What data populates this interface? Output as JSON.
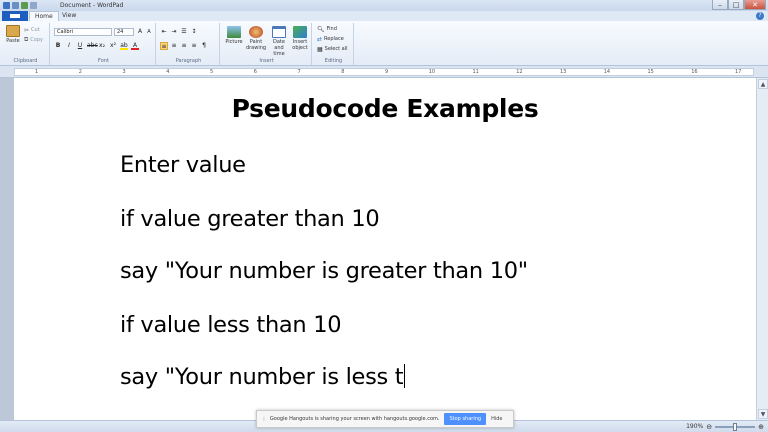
{
  "window": {
    "title": "Document - WordPad",
    "minimize": "–",
    "maximize": "□",
    "close": "✕"
  },
  "tabs": {
    "file": "",
    "home": "Home",
    "view": "View",
    "help": "?"
  },
  "ribbon": {
    "clipboard": {
      "paste": "Paste",
      "cut": "Cut",
      "copy": "Copy",
      "label": "Clipboard"
    },
    "font": {
      "family": "Calibri",
      "size": "24",
      "label": "Font",
      "bold": "B",
      "italic": "I",
      "underline": "U"
    },
    "paragraph": {
      "label": "Paragraph"
    },
    "insert": {
      "picture": "Picture",
      "paint": "Paint drawing",
      "datetime": "Date and time",
      "object": "Insert object",
      "label": "Insert"
    },
    "editing": {
      "find": "Find",
      "replace": "Replace",
      "select_all": "Select all",
      "label": "Editing"
    }
  },
  "ruler": {
    "ticks": [
      "1",
      "2",
      "3",
      "4",
      "5",
      "6",
      "7",
      "8",
      "9",
      "10",
      "11",
      "12",
      "13",
      "14",
      "15",
      "16",
      "17"
    ]
  },
  "document": {
    "title": "Pseudocode Examples",
    "lines": [
      "Enter value",
      "if value greater than 10",
      "say \"Your number is greater than 10\"",
      "if value less than 10",
      "say \"Your number is less t"
    ]
  },
  "status": {
    "zoom": "190%"
  },
  "banner": {
    "message": "Google Hangouts is sharing your screen with hangouts.google.com.",
    "stop": "Stop sharing",
    "hide": "Hide"
  },
  "colors": {
    "file_tab": "#1e5ebf",
    "stop_button": "#4d90fe"
  }
}
